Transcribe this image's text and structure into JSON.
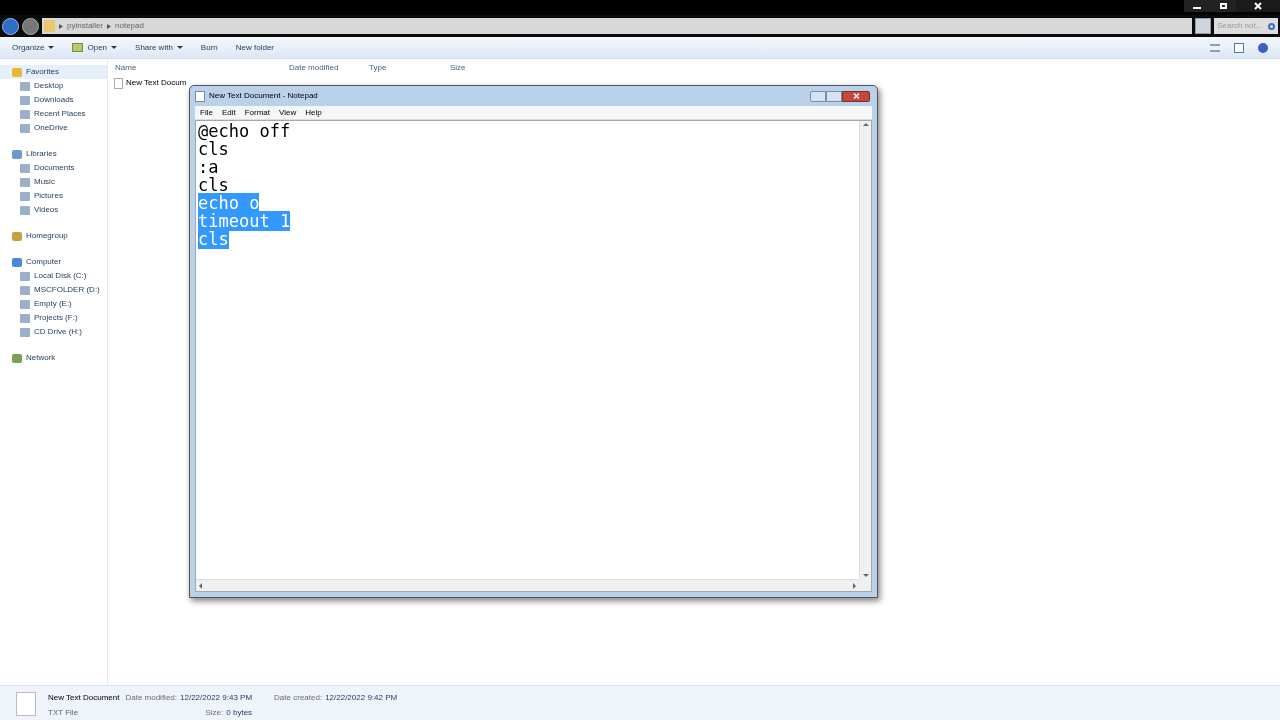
{
  "address_bar": {
    "path": [
      "pyinstaller",
      "notepad"
    ],
    "search_placeholder": "Search not..."
  },
  "toolbar": {
    "buttons": [
      {
        "label": "Organize",
        "dropdown": true
      },
      {
        "label": "Open",
        "dropdown": true
      },
      {
        "label": "Share with",
        "dropdown": true
      },
      {
        "label": "Burn",
        "dropdown": false
      },
      {
        "label": "New folder",
        "dropdown": false
      }
    ]
  },
  "sidebar": {
    "items": [
      {
        "label": "Favorites",
        "selected": true,
        "children": [
          {
            "label": "Desktop",
            "selected": false
          },
          {
            "label": "Downloads",
            "selected": false
          },
          {
            "label": "Recent Places",
            "selected": false
          },
          {
            "label": "OneDrive",
            "selected": false
          }
        ]
      },
      {
        "label": "Libraries",
        "selected": false,
        "children": [
          {
            "label": "Documents",
            "selected": false
          },
          {
            "label": "Music",
            "selected": false
          },
          {
            "label": "Pictures",
            "selected": false
          },
          {
            "label": "Videos",
            "selected": false
          }
        ]
      },
      {
        "label": "Homegroup",
        "selected": false
      },
      {
        "label": "Computer",
        "selected": false,
        "children": [
          {
            "label": "Local Disk (C:)",
            "selected": false
          },
          {
            "label": "MSCFOLDER (D:)",
            "selected": false
          },
          {
            "label": "Empty (E:)",
            "selected": false
          },
          {
            "label": "Projects (F:)",
            "selected": false
          },
          {
            "label": "CD Drive (H:)",
            "selected": false
          }
        ]
      },
      {
        "label": "Network",
        "selected": false
      }
    ]
  },
  "file_list": {
    "columns": [
      "Name",
      "Date modified",
      "Type",
      "Size"
    ],
    "rows": [
      {
        "name": "New Text Docum"
      }
    ]
  },
  "notepad": {
    "title": "New Text Document - Notepad",
    "menu": [
      "File",
      "Edit",
      "Format",
      "View",
      "Help"
    ],
    "lines": [
      {
        "text": "@echo off",
        "selected": false
      },
      {
        "text": "cls",
        "selected": false
      },
      {
        "text": ":a",
        "selected": false
      },
      {
        "text": "cls",
        "selected": false
      },
      {
        "text": "echo o",
        "selected": true
      },
      {
        "text": "timeout 1",
        "selected": true
      },
      {
        "text": "cls",
        "selected": true
      }
    ]
  },
  "details_pane": {
    "name": "New Text Document",
    "type": "TXT File",
    "fields": [
      {
        "label": "Date modified:",
        "value": "12/22/2022 9:43 PM"
      },
      {
        "label": "Size:",
        "value": "0 bytes"
      },
      {
        "label": "Date created:",
        "value": "12/22/2022 9:42 PM"
      }
    ]
  }
}
